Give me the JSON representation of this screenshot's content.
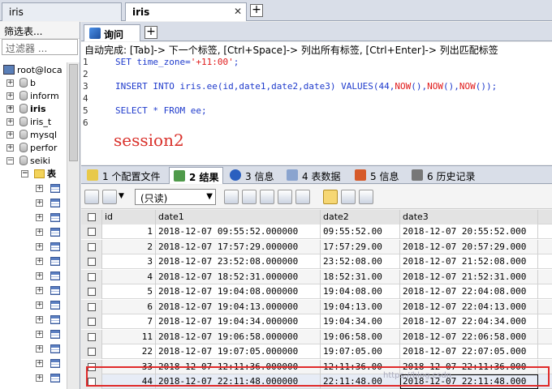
{
  "window_tabs": [
    {
      "label": "iris"
    },
    {
      "label": "iris"
    }
  ],
  "left_panel": {
    "filter_label": "筛选表...",
    "filter_placeholder": "过滤器 ...",
    "root": "root@loca",
    "dbs": [
      "b",
      "inform",
      "iris",
      "iris_t",
      "mysql",
      "perfor",
      "seiki"
    ],
    "tables_folder": "表"
  },
  "query_tab": {
    "label": "询问"
  },
  "hint": "自动完成: [Tab]-> 下一个标签, [Ctrl+Space]-> 列出所有标签, [Ctrl+Enter]-> 列出匹配标签",
  "editor": {
    "line_numbers": [
      "1",
      "2",
      "3",
      "4",
      "5",
      "6"
    ],
    "l1_kw": "SET",
    "l1_rest": " time_zone=",
    "l1_str": "'+11:00'",
    "l1_end": ";",
    "l3_kw1": "INSERT INTO",
    "l3_mid": " iris.ee(id,date1,date2,date3) ",
    "l3_kw2": "VALUES",
    "l3_open": "(44,",
    "l3_fn1": "NOW",
    "l3_p1": "(),",
    "l3_fn2": "NOW",
    "l3_p2": "(),",
    "l3_fn3": "NOW",
    "l3_p3": "());",
    "l5_kw1": "SELECT",
    "l5_mid": " * ",
    "l5_kw2": "FROM",
    "l5_end": " ee;",
    "session_note": "session2"
  },
  "result_tabs": [
    {
      "num": "1",
      "label": "1 个配置文件"
    },
    {
      "num": "2",
      "label": "2 结果"
    },
    {
      "num": "3",
      "label": "3 信息"
    },
    {
      "num": "4",
      "label": "4 表数据"
    },
    {
      "num": "5",
      "label": "5 信息"
    },
    {
      "num": "6",
      "label": "6 历史记录"
    }
  ],
  "toolbar": {
    "mode": "(只读)"
  },
  "grid": {
    "columns": [
      "id",
      "date1",
      "date2",
      "date3"
    ],
    "rows": [
      [
        "1",
        "2018-12-07 09:55:52.000000",
        "09:55:52.00",
        "2018-12-07 20:55:52.000"
      ],
      [
        "2",
        "2018-12-07 17:57:29.000000",
        "17:57:29.00",
        "2018-12-07 20:57:29.000"
      ],
      [
        "3",
        "2018-12-07 23:52:08.000000",
        "23:52:08.00",
        "2018-12-07 21:52:08.000"
      ],
      [
        "4",
        "2018-12-07 18:52:31.000000",
        "18:52:31.00",
        "2018-12-07 21:52:31.000"
      ],
      [
        "5",
        "2018-12-07 19:04:08.000000",
        "19:04:08.00",
        "2018-12-07 22:04:08.000"
      ],
      [
        "6",
        "2018-12-07 19:04:13.000000",
        "19:04:13.00",
        "2018-12-07 22:04:13.000"
      ],
      [
        "7",
        "2018-12-07 19:04:34.000000",
        "19:04:34.00",
        "2018-12-07 22:04:34.000"
      ],
      [
        "11",
        "2018-12-07 19:06:58.000000",
        "19:06:58.00",
        "2018-12-07 22:06:58.000"
      ],
      [
        "22",
        "2018-12-07 19:07:05.000000",
        "19:07:05.00",
        "2018-12-07 22:07:05.000"
      ],
      [
        "33",
        "2018-12-07 12:11:36.000000",
        "12:11:36.00",
        "2018-12-07 22:11:36.000"
      ],
      [
        "44",
        "2018-12-07 22:11:48.000000",
        "22:11:48.00",
        "2018-12-07 22:11:48.000"
      ]
    ]
  },
  "watermark": "https://blog.csdn"
}
